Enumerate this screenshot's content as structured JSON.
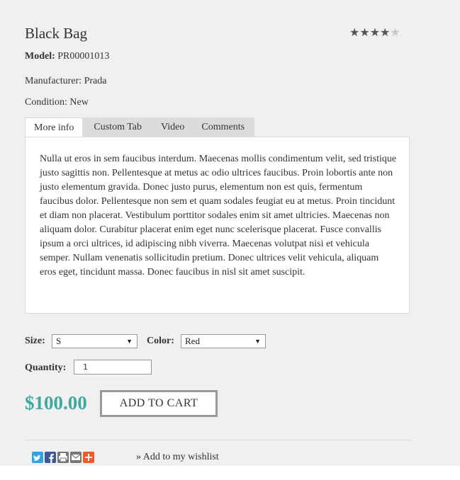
{
  "product": {
    "title": "Black Bag",
    "rating": 4,
    "rating_max": 5,
    "model_label": "Model:",
    "model_value": "PR00001013",
    "manufacturer": "Manufacturer: Prada",
    "condition": "Condition: New"
  },
  "tabs": [
    {
      "label": "More info",
      "active": true
    },
    {
      "label": "Custom Tab",
      "active": false
    },
    {
      "label": "Video",
      "active": false
    },
    {
      "label": "Comments",
      "active": false
    }
  ],
  "description": "Nulla ut eros in sem faucibus interdum. Maecenas mollis condimentum velit, sed tristique justo sagittis non. Pellentesque at metus ac odio ultrices faucibus. Proin lobortis ante non justo elementum gravida. Donec justo purus, elementum non est quis, fermentum faucibus dolor. Pellentesque non sem et quam sodales feugiat eu at metus. Proin tincidunt et diam non placerat. Vestibulum porttitor sodales enim sit amet ultricies. Maecenas non aliquam dolor. Curabitur placerat enim eget nunc scelerisque placerat. Fusce convallis ipsum a orci ultrices, id adipiscing nibh viverra. Maecenas volutpat nisi et vehicula semper. Nullam venenatis sollicitudin pretium. Donec ultrices velit vehicula, aliquam eros eget, tincidunt massa. Donec faucibus in nisl sit amet suscipit.",
  "options": {
    "size_label": "Size:",
    "size_value": "S",
    "color_label": "Color:",
    "color_value": "Red",
    "quantity_label": "Quantity:",
    "quantity_value": "1"
  },
  "price": "$100.00",
  "add_to_cart": "ADD TO CART",
  "wishlist": "» Add to my wishlist",
  "share_icons": [
    "twitter-icon",
    "facebook-icon",
    "print-icon",
    "email-icon",
    "addthis-plus-icon"
  ],
  "colors": {
    "price": "#40a8a0",
    "twitter": "#2fa3e6",
    "facebook": "#3b5998",
    "print": "#777777",
    "email": "#777777",
    "plus": "#f1592a"
  }
}
